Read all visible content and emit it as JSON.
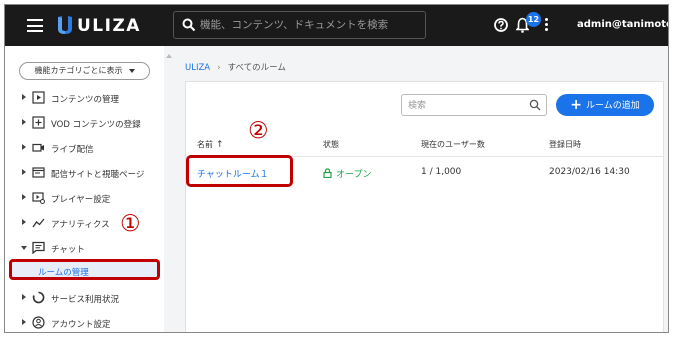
{
  "header": {
    "logo_text": "ULIZA",
    "search_placeholder": "機能、コンテンツ、ドキュメントを検索",
    "notification_count": "12",
    "username": "admin@tanimoto",
    "icons": [
      "menu-icon",
      "uliza-logo-icon",
      "search-icon",
      "help-icon",
      "bell-icon",
      "more-vert-icon"
    ]
  },
  "sidebar": {
    "view_toggle_label": "機能カテゴリごとに表示",
    "items": [
      {
        "label": "コンテンツの管理",
        "icon": "content-icon"
      },
      {
        "label": "VOD コンテンツの登録",
        "icon": "add-box-icon"
      },
      {
        "label": "ライブ配信",
        "icon": "live-camera-icon"
      },
      {
        "label": "配信サイトと視聴ページ",
        "icon": "site-icon"
      },
      {
        "label": "プレイヤー設定",
        "icon": "player-settings-icon"
      },
      {
        "label": "アナリティクス",
        "icon": "analytics-icon"
      },
      {
        "label": "チャット",
        "icon": "chat-icon"
      },
      {
        "label": "サービス利用状況",
        "icon": "usage-icon"
      },
      {
        "label": "アカウント設定",
        "icon": "account-icon"
      }
    ],
    "subitem": {
      "label": "ルームの管理"
    }
  },
  "markers": {
    "one": "①",
    "two": "②"
  },
  "breadcrumb": {
    "home": "ULIZA",
    "separator": "›",
    "current": "すべてのルーム"
  },
  "room_search": {
    "placeholder": "検索"
  },
  "add_room_label": "ルームの追加",
  "table": {
    "headers": {
      "name": "名前",
      "name_sort": "↑",
      "status": "状態",
      "users": "現在のユーザー数",
      "date": "登録日時"
    },
    "rows": [
      {
        "name": "チャットルーム１",
        "status": "オープン",
        "users": "1 / 1,000",
        "date": "2023/02/16 14:30"
      }
    ]
  },
  "colors": {
    "accent": "#1a73e8",
    "topbar": "#1a1a1a",
    "highlight": "#c00000",
    "status_open": "#22a34a"
  }
}
